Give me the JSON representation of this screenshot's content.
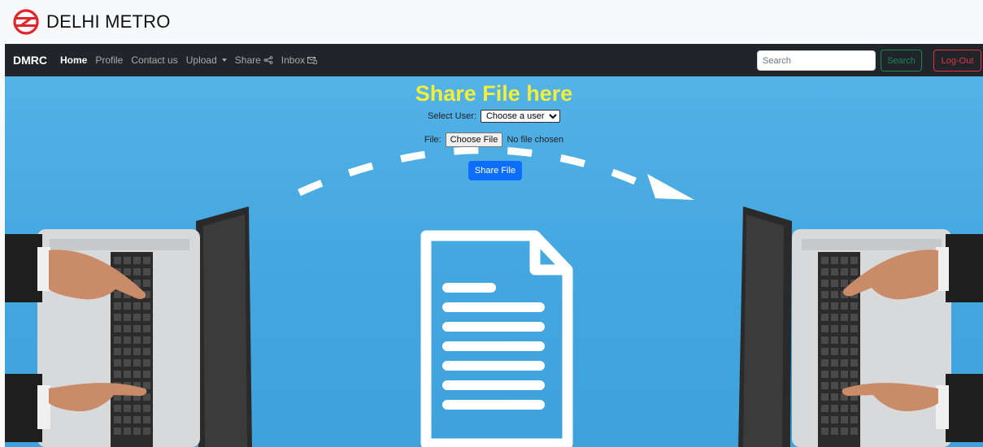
{
  "brand": {
    "title": "DELHI METRO",
    "logo_color": "#e3242b"
  },
  "navbar": {
    "brand": "DMRC",
    "links": [
      {
        "label": "Home",
        "active": true
      },
      {
        "label": "Profile"
      },
      {
        "label": "Contact us"
      },
      {
        "label": "Upload",
        "dropdown": true
      },
      {
        "label": "Share",
        "icon": "share-icon"
      },
      {
        "label": "Inbox",
        "icon": "inbox-icon"
      }
    ],
    "search_placeholder": "Search",
    "search_button": "Search",
    "logout_button": "Log-Out"
  },
  "form": {
    "title": "Share File here",
    "select_label": "Select User:",
    "select_value": "Choose a user",
    "file_label": "File:",
    "file_button": "Choose File",
    "file_status": "No file chosen",
    "submit": "Share File"
  },
  "colors": {
    "title_yellow": "#f3ee3a",
    "hero_blue": "#4aa9e1",
    "primary": "#0d6efd",
    "success": "#198754",
    "danger": "#dc3545",
    "navbar": "#212529"
  }
}
